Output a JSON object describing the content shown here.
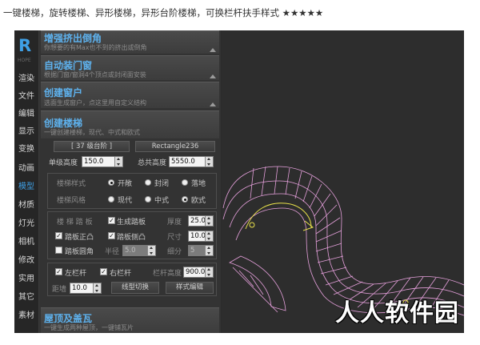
{
  "caption": "一键楼梯，旋转楼梯、异形楼梯，异形台阶楼梯，可换栏杆扶手样式 ★★★★★",
  "app": {
    "logo": "R",
    "version": "HOPE",
    "nav": [
      "渲染",
      "文件",
      "编辑",
      "显示",
      "变换",
      "动画",
      "模型",
      "材质",
      "灯光",
      "相机",
      "修改",
      "实用",
      "其它",
      "素材"
    ],
    "nav_active": "模型",
    "accent_color": "#3fa0e6"
  },
  "sections": {
    "s1": {
      "title": "增强挤出倒角",
      "subtitle": "你想要的有Max也不到的挤出或倒角"
    },
    "s2": {
      "title": "自动装门窗",
      "subtitle": "根据门窗/窗洞4个顶点或封闭面安装"
    },
    "s3": {
      "title": "创建窗户",
      "subtitle": "选面生成窗户，点这里用自定义结构"
    },
    "s4": {
      "title": "创建楼梯",
      "subtitle": "一键创建楼梯，现代、中式和欧式"
    },
    "s5": {
      "title": "屋顶及盖瓦",
      "subtitle": "一键生成两种屋顶，一键铺瓦片"
    }
  },
  "stairs": {
    "btn_steps": "[ 37 级台阶 ]",
    "btn_shape": "Rectangle236",
    "step_height_label": "单级高度",
    "step_height_value": "150.0",
    "total_height_label": "总共高度",
    "total_height_value": "5550.0",
    "stair_style_label": "楼梯样式",
    "stair_style_options": [
      "开敞",
      "封闭",
      "落地"
    ],
    "stair_style_selected": "开敞",
    "stair_design_label": "楼梯风格",
    "stair_design_options": [
      "现代",
      "中式",
      "欧式"
    ],
    "stair_design_selected": "欧式",
    "stair_trim_label": "楼 梯 踏 板",
    "chk_gen_tread": "生成踏板",
    "thickness_label": "厚度",
    "thickness_value": "25.0",
    "chk_tread_convex": "踏板正凸",
    "chk_tread_side": "踏板侧凸",
    "size_label": "尺寸",
    "size_value": "10.0",
    "chk_tread_round": "踏板圆角",
    "radius_label": "半径",
    "radius_value": "5.0",
    "segments_label": "细分",
    "segments_value": "5",
    "chk_left_rail": "左栏杆",
    "chk_right_rail": "右栏杆",
    "rail_height_label": "栏杆高度",
    "rail_height_value": "900.0",
    "pitch_label": "距墙",
    "pitch_value": "10.0",
    "btn_line_switch": "线型切换",
    "btn_style_edit": "样式编辑"
  },
  "watermark": "人人软件园",
  "viewport": {
    "wire_color": "#e6a0dc",
    "path_color": "#e8e04a"
  }
}
